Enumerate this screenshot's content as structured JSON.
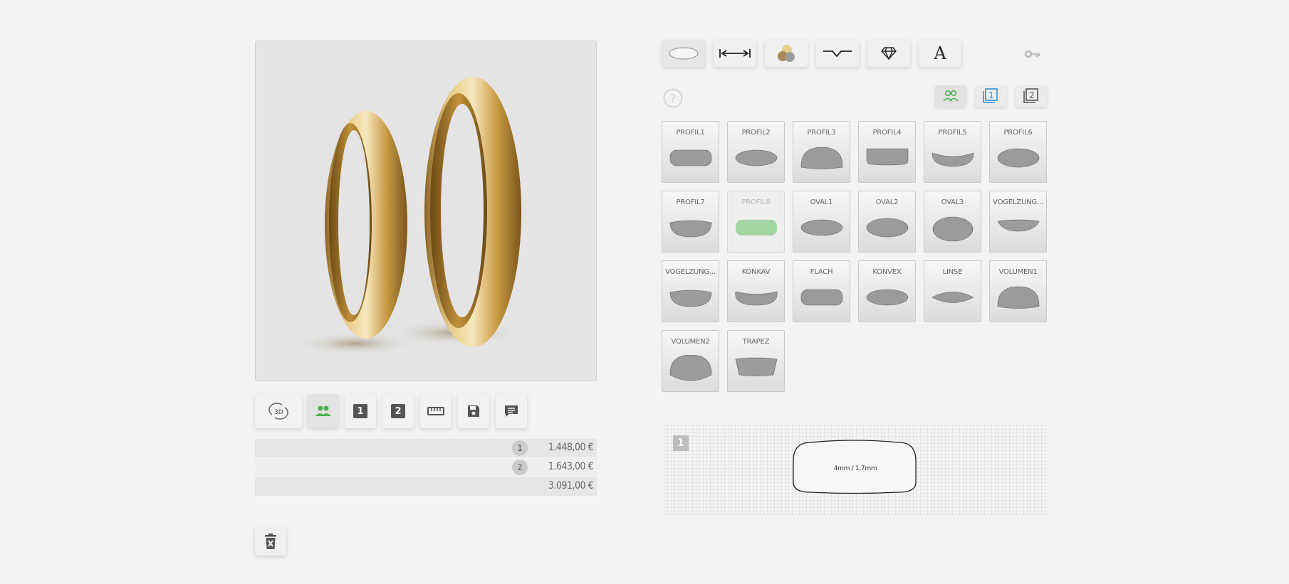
{
  "toolbar": {
    "view_3d_label": "3D",
    "ring1_label": "1",
    "ring2_label": "2"
  },
  "prices": [
    {
      "ring": "1",
      "amount": "1.448,00 €"
    },
    {
      "ring": "2",
      "amount": "1.643,00 €"
    },
    {
      "ring": "",
      "amount": "3.091,00 €"
    }
  ],
  "top_tabs": [
    {
      "name": "profile-tab",
      "icon": "profile-ellipse-icon"
    },
    {
      "name": "width-tab",
      "icon": "width-arrows-icon"
    },
    {
      "name": "color-tab",
      "icon": "metal-colors-icon"
    },
    {
      "name": "surface-tab",
      "icon": "wave-line-icon"
    },
    {
      "name": "stone-tab",
      "icon": "diamond-icon"
    },
    {
      "name": "engraving-tab",
      "icon": "letter-a-icon",
      "label": "A"
    }
  ],
  "ring_select": {
    "ring1": "1",
    "ring2": "2"
  },
  "profiles": [
    {
      "label": "PROFIL1",
      "shape": "rect-round"
    },
    {
      "label": "PROFIL2",
      "shape": "ellipse-thin"
    },
    {
      "label": "PROFIL3",
      "shape": "dome"
    },
    {
      "label": "PROFIL4",
      "shape": "rect-flat"
    },
    {
      "label": "PROFIL5",
      "shape": "concave-band"
    },
    {
      "label": "PROFIL6",
      "shape": "ellipse"
    },
    {
      "label": "PROFIL7",
      "shape": "half-dome"
    },
    {
      "label": "PROFIL8",
      "shape": "rect-round",
      "selected": true
    },
    {
      "label": "OVAL1",
      "shape": "ellipse-thin"
    },
    {
      "label": "OVAL2",
      "shape": "ellipse"
    },
    {
      "label": "OVAL3",
      "shape": "ellipse-tall"
    },
    {
      "label": "VOGELZUNG...",
      "shape": "birdtongue"
    },
    {
      "label": "VOGELZUNG...",
      "shape": "half-dome"
    },
    {
      "label": "KONKAV",
      "shape": "concave"
    },
    {
      "label": "FLACH",
      "shape": "rect-round"
    },
    {
      "label": "KONVEX",
      "shape": "ellipse-thin"
    },
    {
      "label": "LINSE",
      "shape": "lens"
    },
    {
      "label": "VOLUMEN1",
      "shape": "dome"
    },
    {
      "label": "VOLUMEN2",
      "shape": "dome-high"
    },
    {
      "label": "TRAPEZ",
      "shape": "trapezoid"
    }
  ],
  "cross_section": {
    "ring": "1",
    "dimension": "4mm / 1,7mm"
  },
  "colors": {
    "accent_green": "#4caf50",
    "accent_blue": "#2d8fd6",
    "selected_fill": "#9ed5a0",
    "shape_fill": "#9b9b9b",
    "gold": "#d9b35c"
  }
}
